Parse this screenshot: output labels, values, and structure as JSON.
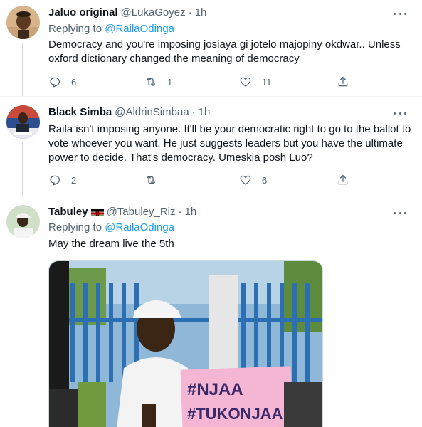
{
  "tweets": [
    {
      "name": "Jaluo original",
      "handle": "@LukaGoyez",
      "time": "1h",
      "replying_prefix": "Replying to",
      "replying_mention": "@RailaOdinga",
      "text": "Democracy and you're imposing josiaya gi jotelo majopiny okdwar.. Unless oxford dictionary changed the meaning of democracy",
      "replies": "6",
      "retweets": "1",
      "likes": "11",
      "avatar_icon": "avatar-man-photo"
    },
    {
      "name": "Black Simba",
      "handle": "@AldrinSimbaa",
      "time": "1h",
      "text": "Raila isn't imposing anyone. It'll be your democratic right to go to the ballot to vote whoever you want. He just suggests leaders but you have the ultimate power to decide. That's democracy. Umeskia posh Luo?",
      "replies": "2",
      "retweets": "",
      "likes": "6",
      "avatar_icon": "avatar-speaker-photo"
    },
    {
      "name": "Tabuley",
      "handle": "@Tabuley_Riz",
      "time": "1h",
      "replying_prefix": "Replying to",
      "replying_mention": "@RailaOdinga",
      "text": "May the dream live the 5th",
      "avatar_icon": "avatar-cap-photo",
      "flag_icon": "kenya-flag-icon",
      "media": {
        "sign_line1": "#NJAA",
        "sign_line2": "#TUKONJAA"
      }
    }
  ],
  "separator": "·",
  "colors": {
    "accent": "#1d9bf0",
    "secondary_text": "#536471",
    "border": "#eff3f4"
  }
}
